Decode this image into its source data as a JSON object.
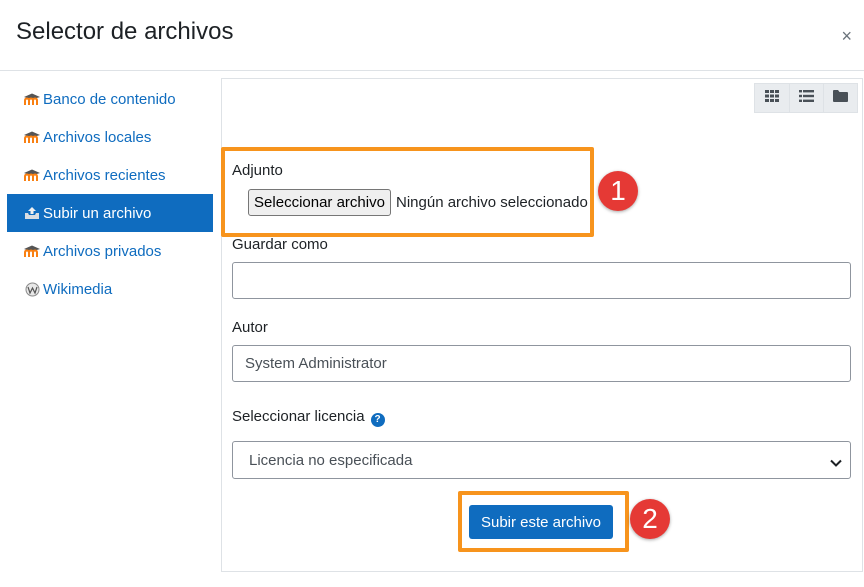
{
  "dialog": {
    "title": "Selector de archivos",
    "close_symbol": "×"
  },
  "sidebar": {
    "items": [
      {
        "label": "Banco de contenido",
        "icon": "moodle-icon"
      },
      {
        "label": "Archivos locales",
        "icon": "moodle-icon"
      },
      {
        "label": "Archivos recientes",
        "icon": "moodle-icon"
      },
      {
        "label": "Subir un archivo",
        "icon": "upload-icon",
        "active": true
      },
      {
        "label": "Archivos privados",
        "icon": "moodle-icon"
      },
      {
        "label": "Wikimedia",
        "icon": "wikimedia-icon"
      }
    ]
  },
  "toolbar": {
    "views": [
      "grid-view-icon",
      "list-view-icon",
      "folder-view-icon"
    ]
  },
  "form": {
    "attachment_label": "Adjunto",
    "choose_file_label": "Seleccionar archivo",
    "no_file_text": "Ningún archivo seleccionado",
    "save_as_label": "Guardar como",
    "save_as_value": "",
    "author_label": "Autor",
    "author_value": "System Administrator",
    "license_label": "Seleccionar licencia",
    "license_value": "Licencia no especificada",
    "submit_label": "Subir este archivo"
  },
  "annotations": {
    "step1": "1",
    "step2": "2"
  },
  "colors": {
    "primary": "#0f6cbf",
    "highlight": "#f7941d",
    "badge": "#e53935",
    "moodle_orange": "#f98012"
  }
}
